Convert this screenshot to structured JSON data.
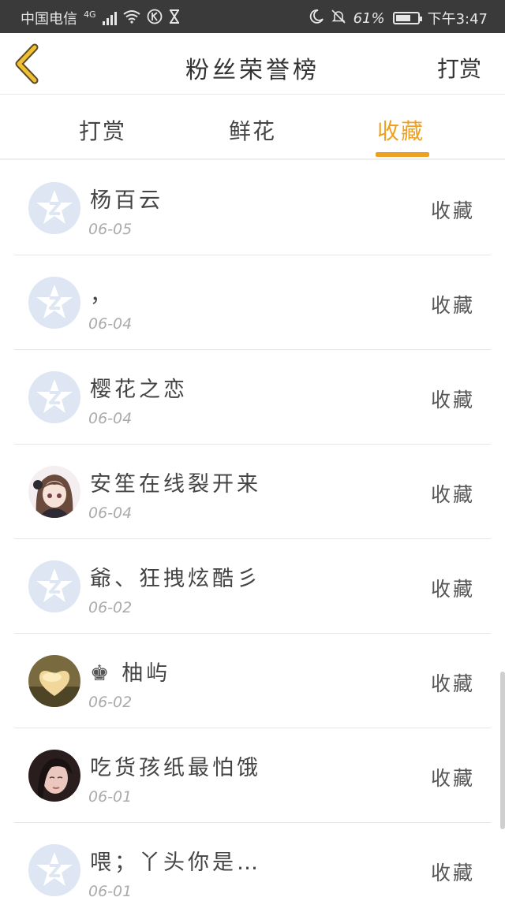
{
  "status_bar": {
    "carrier": "中国电信",
    "network": "4G",
    "battery": "61%",
    "battery_level": 0.61,
    "time": "下午3:47"
  },
  "nav": {
    "title": "粉丝荣誉榜",
    "action": "打赏",
    "back_icon": "chevron-left-icon",
    "accent": "#f0a020"
  },
  "tabs": [
    {
      "label": "打赏",
      "active": false
    },
    {
      "label": "鲜花",
      "active": false
    },
    {
      "label": "收藏",
      "active": true
    }
  ],
  "list": [
    {
      "name": "杨百云",
      "date": "06-05",
      "action": "收藏",
      "avatar": "default-star"
    },
    {
      "name": "，",
      "date": "06-04",
      "action": "收藏",
      "avatar": "default-star"
    },
    {
      "name": "樱花之恋",
      "date": "06-04",
      "action": "收藏",
      "avatar": "default-star"
    },
    {
      "name": "安笙在线裂开来",
      "date": "06-04",
      "action": "收藏",
      "avatar": "anime-girl"
    },
    {
      "name": "爺、狂拽炫酷彡",
      "date": "06-02",
      "action": "收藏",
      "avatar": "default-star"
    },
    {
      "name": "柚屿",
      "prefix": "♚",
      "date": "06-02",
      "action": "收藏",
      "avatar": "heart"
    },
    {
      "name": "吃货孩纸最怕饿",
      "date": "06-01",
      "action": "收藏",
      "avatar": "girl-photo"
    },
    {
      "name": "喂；丫头你是…",
      "date": "06-01",
      "action": "收藏",
      "avatar": "default-star"
    }
  ]
}
